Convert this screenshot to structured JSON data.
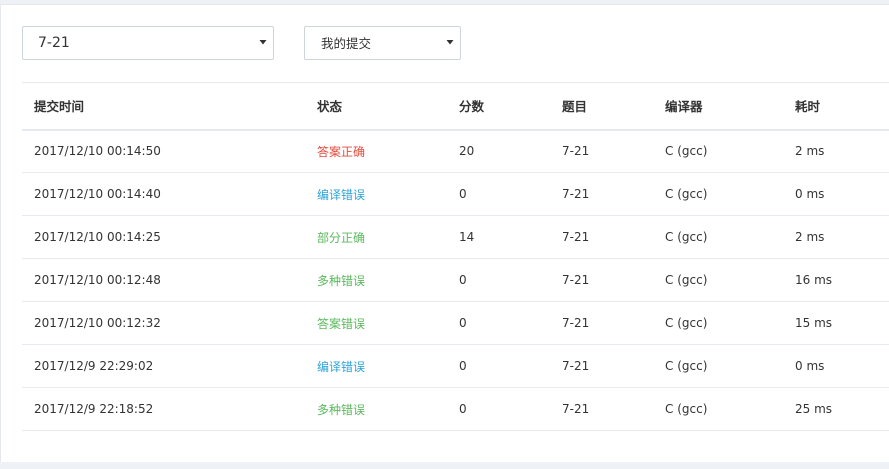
{
  "filters": {
    "problem": "7-21",
    "scope": "我的提交"
  },
  "columns": [
    "提交时间",
    "状态",
    "分数",
    "题目",
    "编译器",
    "耗时"
  ],
  "rows": [
    {
      "time": "2017/12/10 00:14:50",
      "status": "答案正确",
      "score": "20",
      "problem": "7-21",
      "compiler": "C (gcc)",
      "elapsed": "2 ms"
    },
    {
      "time": "2017/12/10 00:14:40",
      "status": "编译错误",
      "score": "0",
      "problem": "7-21",
      "compiler": "C (gcc)",
      "elapsed": "0 ms"
    },
    {
      "time": "2017/12/10 00:14:25",
      "status": "部分正确",
      "score": "14",
      "problem": "7-21",
      "compiler": "C (gcc)",
      "elapsed": "2 ms"
    },
    {
      "time": "2017/12/10 00:12:48",
      "status": "多种错误",
      "score": "0",
      "problem": "7-21",
      "compiler": "C (gcc)",
      "elapsed": "16 ms"
    },
    {
      "time": "2017/12/10 00:12:32",
      "status": "答案错误",
      "score": "0",
      "problem": "7-21",
      "compiler": "C (gcc)",
      "elapsed": "15 ms"
    },
    {
      "time": "2017/12/9 22:29:02",
      "status": "编译错误",
      "score": "0",
      "problem": "7-21",
      "compiler": "C (gcc)",
      "elapsed": "0 ms"
    },
    {
      "time": "2017/12/9 22:18:52",
      "status": "多种错误",
      "score": "0",
      "problem": "7-21",
      "compiler": "C (gcc)",
      "elapsed": "25 ms"
    }
  ],
  "status_colors": {
    "答案正确": "#e14c3c",
    "编译错误": "#2fa4d6",
    "部分正确": "#5bb85d",
    "多种错误": "#5bb85d",
    "答案错误": "#5bb85d"
  }
}
